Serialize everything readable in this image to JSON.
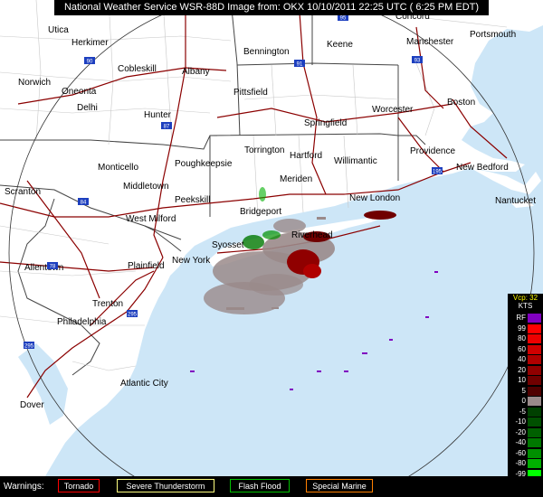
{
  "title": "National Weather Service WSR-88D Image from: OKX 10/10/2011  22:25 UTC  ( 6:25 PM EDT)",
  "cities": [
    {
      "name": "Concord"
    },
    {
      "name": "Utica"
    },
    {
      "name": "Herkimer"
    },
    {
      "name": "Bennington"
    },
    {
      "name": "Keene"
    },
    {
      "name": "Manchester"
    },
    {
      "name": "Portsmouth"
    },
    {
      "name": "Cobleskill"
    },
    {
      "name": "Albany"
    },
    {
      "name": "Norwich"
    },
    {
      "name": "Oneonta"
    },
    {
      "name": "Delhi"
    },
    {
      "name": "Pittsfield"
    },
    {
      "name": "Worcester"
    },
    {
      "name": "Boston"
    },
    {
      "name": "Hunter"
    },
    {
      "name": "Springfield"
    },
    {
      "name": "Torrington"
    },
    {
      "name": "Hartford"
    },
    {
      "name": "Willimantic"
    },
    {
      "name": "Providence"
    },
    {
      "name": "New Bedford"
    },
    {
      "name": "Monticello"
    },
    {
      "name": "Poughkeepsie"
    },
    {
      "name": "Scranton"
    },
    {
      "name": "Middletown"
    },
    {
      "name": "Meriden"
    },
    {
      "name": "New London"
    },
    {
      "name": "Nantucket"
    },
    {
      "name": "Peekskill"
    },
    {
      "name": "Bridgeport"
    },
    {
      "name": "West Milford"
    },
    {
      "name": "Riverhead"
    },
    {
      "name": "Syosset"
    },
    {
      "name": "Allentown"
    },
    {
      "name": "Plainfield"
    },
    {
      "name": "New York"
    },
    {
      "name": "Trenton"
    },
    {
      "name": "Philadelphia"
    },
    {
      "name": "Atlantic City"
    },
    {
      "name": "Dover"
    }
  ],
  "highways": [
    "95",
    "90",
    "87",
    "91",
    "93",
    "84",
    "78",
    "195",
    "295",
    "295"
  ],
  "legend": {
    "header": "Vcp: 32",
    "unit": "KTS",
    "rows": [
      {
        "label": "RF",
        "color": "#8000c0"
      },
      {
        "label": "99",
        "color": "#ff0000"
      },
      {
        "label": "80",
        "color": "#ee0000"
      },
      {
        "label": "60",
        "color": "#d00000"
      },
      {
        "label": "40",
        "color": "#b00000"
      },
      {
        "label": "20",
        "color": "#900000"
      },
      {
        "label": "10",
        "color": "#700000"
      },
      {
        "label": "5",
        "color": "#500000"
      },
      {
        "label": "0",
        "color": "#9a8a8a"
      },
      {
        "label": "-5",
        "color": "#004000"
      },
      {
        "label": "-10",
        "color": "#005000"
      },
      {
        "label": "-20",
        "color": "#006000"
      },
      {
        "label": "-40",
        "color": "#007800"
      },
      {
        "label": "-60",
        "color": "#009000"
      },
      {
        "label": "-80",
        "color": "#00b000"
      },
      {
        "label": "-99",
        "color": "#00ff00"
      },
      {
        "label": "ND",
        "color": "#ffffff"
      }
    ]
  },
  "warnings": {
    "label": "Warnings:",
    "items": [
      {
        "label": "Tornado",
        "color": "#ff0000"
      },
      {
        "label": "Severe Thunderstorm",
        "color": "#ffff80"
      },
      {
        "label": "Flash Flood",
        "color": "#00c000"
      },
      {
        "label": "Special Marine",
        "color": "#ff8000"
      }
    ]
  }
}
